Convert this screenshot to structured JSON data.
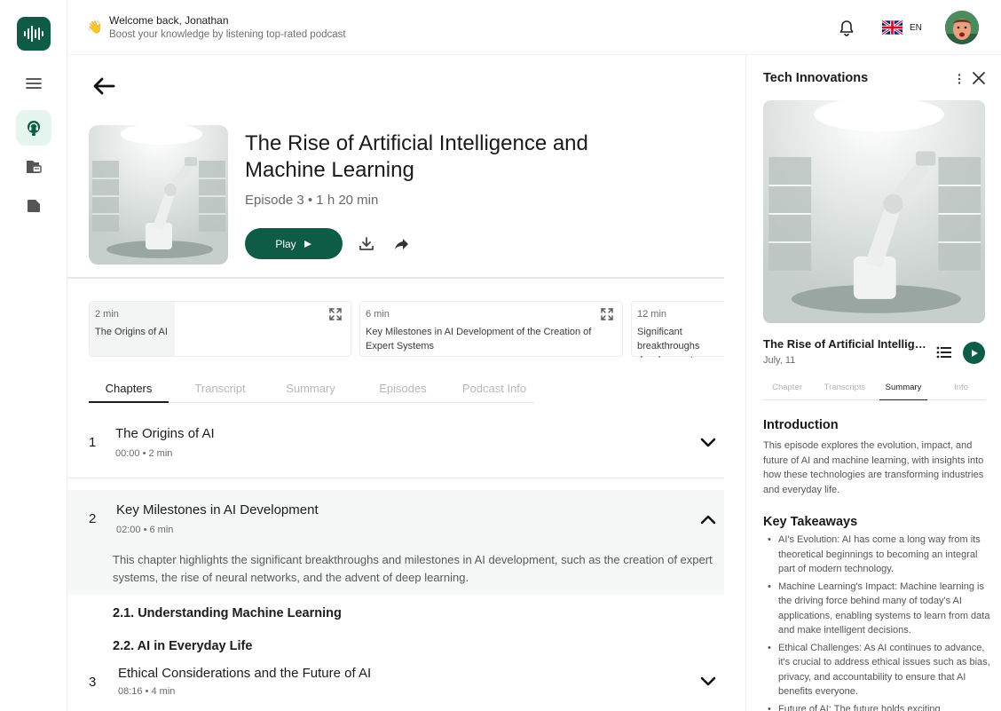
{
  "header": {
    "wave_emoji": "👋",
    "welcome": "Welcome back, Jonathan",
    "tagline": "Boost your knowledge by listening top-rated podcast",
    "language": "EN"
  },
  "episode": {
    "title": "The Rise of Artificial Intelligence and Machine Learning",
    "meta": "Episode 3 • 1 h 20 min",
    "play_label": "Play"
  },
  "chapter_cards": [
    {
      "duration": "2 min",
      "name": "The Origins of AI"
    },
    {
      "duration": "6 min",
      "name": "Key Milestones in AI Development of the Creation of Expert Systems"
    },
    {
      "duration": "12 min",
      "name": "Significant breakthroughs development"
    }
  ],
  "tabs": [
    "Chapters",
    "Transcript",
    "Summary",
    "Episodes",
    "Podcast Info"
  ],
  "chapters": [
    {
      "num": "1",
      "title": "The Origins of AI",
      "time": "00:00 • 2 min"
    },
    {
      "num": "2",
      "title": "Key Milestones in AI Development",
      "time": "02:00 • 6 min",
      "description": "This chapter highlights the significant breakthroughs and milestones in AI development, such as the creation of expert systems, the rise of neural networks, and the advent of deep learning."
    },
    {
      "num": "3",
      "title": "Ethical Considerations and the Future of AI",
      "time": "08:16 • 4 min"
    }
  ],
  "subsections": [
    "2.1. Understanding Machine Learning",
    "2.2. AI in Everyday Life"
  ],
  "panel": {
    "heading": "Tech Innovations",
    "title": "The Rise of Artificial Intelligence and Machine Learning",
    "date": "July, 11",
    "tabs": [
      "Chapter",
      "Transcripts",
      "Summary",
      "Info"
    ],
    "intro_heading": "Introduction",
    "intro_text": "This episode explores the evolution, impact, and future of AI and machine learning, with insights into how these technologies are transforming industries and everyday life.",
    "takeaways_heading": "Key Takeaways",
    "takeaways": [
      "AI's Evolution: AI has come a long way from its theoretical beginnings to becoming an integral part of modern technology.",
      "Machine Learning's Impact: Machine learning is the driving force behind many of today's AI applications, enabling systems to learn from data and make intelligent decisions.",
      "Ethical Challenges: As AI continues to advance, it's crucial to address ethical issues such as bias, privacy, and accountability to ensure that AI benefits everyone.",
      "Future of AI: The future holds exciting"
    ]
  },
  "colors": {
    "brand": "#0f5c46",
    "active_rail": "#e6f6ee"
  },
  "icons": [
    "waveform-logo-icon",
    "menu-icon",
    "podcast-icon",
    "library-icon",
    "folder-icon",
    "bell-icon",
    "uk-flag-icon",
    "back-arrow-icon",
    "play-icon",
    "download-icon",
    "share-icon",
    "expand-icon",
    "chevron-down-icon",
    "chevron-up-icon",
    "more-vertical-icon",
    "close-icon",
    "list-icon"
  ]
}
